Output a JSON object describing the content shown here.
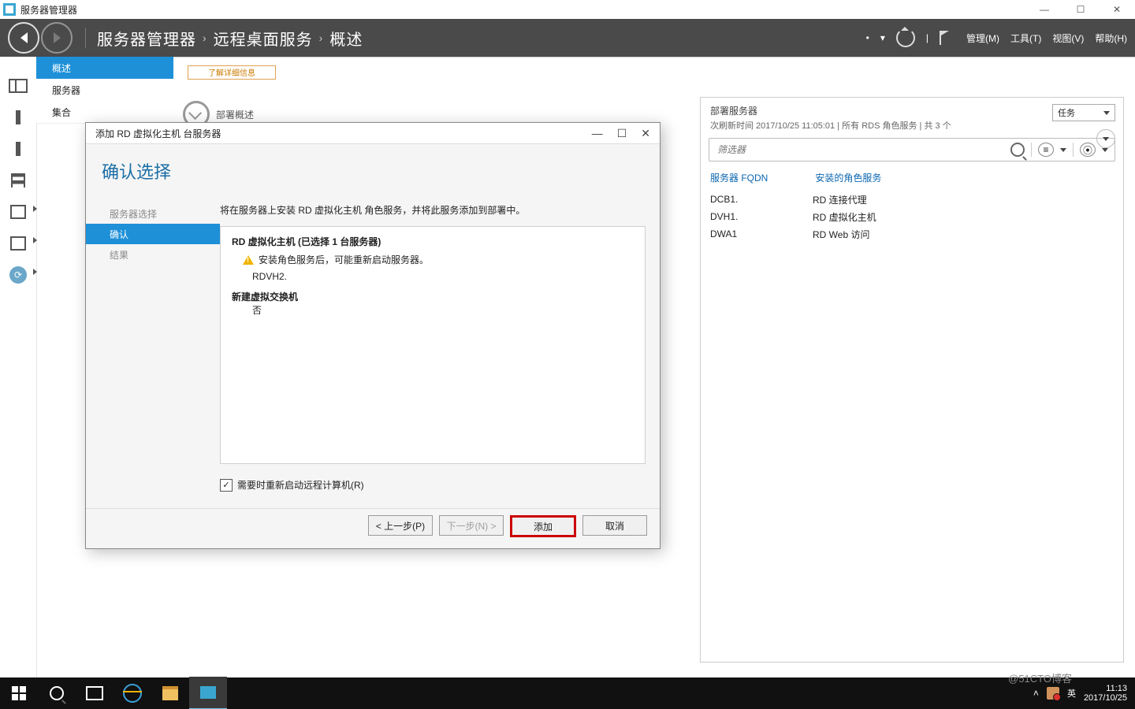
{
  "app_title": "服务器管理器",
  "window_controls": {
    "min": "—",
    "max": "☐",
    "close": "✕"
  },
  "breadcrumb": [
    "服务器管理器",
    "远程桌面服务",
    "概述"
  ],
  "header_menu": {
    "manage": "管理(M)",
    "tools": "工具(T)",
    "view": "视图(V)",
    "help": "帮助(H)"
  },
  "header_misc": {
    "bullet": "•",
    "caret": "▾",
    "vbar": "|"
  },
  "side_nav": {
    "overview": "概述",
    "servers": "服务器",
    "collections": "集合"
  },
  "orange_strip": "了解详细信息",
  "main": {
    "dep_overview_title": "部署概述"
  },
  "right_panel": {
    "title": "部署服务器",
    "sub": "次刷新时间 2017/10/25 11:05:01 | 所有 RDS 角色服务 | 共 3 个",
    "tasks_label": "任务",
    "filter_placeholder": "筛选器",
    "col_fqdn": "服务器 FQDN",
    "col_role": "安装的角色服务",
    "rows": [
      {
        "fqdn": "DCB1.",
        "role": "RD 连接代理"
      },
      {
        "fqdn": "DVH1.",
        "role": "RD 虚拟化主机"
      },
      {
        "fqdn": "DWA1",
        "role": "RD Web 访问"
      }
    ]
  },
  "modal": {
    "title": "添加 RD 虚拟化主机 台服务器",
    "heading": "确认选择",
    "steps": {
      "select": "服务器选择",
      "confirm": "确认",
      "result": "结果"
    },
    "note": "将在服务器上安装 RD 虚拟化主机 角色服务，并将此服务添加到部署中。",
    "host_header": "RD 虚拟化主机  (已选择 1 台服务器)",
    "warn_text": "安装角色服务后，可能重新启动服务器。",
    "server_name": "RDVH2.",
    "switch_header": "新建虚拟交换机",
    "switch_value": "否",
    "checkbox_label": "需要时重新启动远程计算机(R)",
    "buttons": {
      "prev": "< 上一步(P)",
      "next": "下一步(N) >",
      "add": "添加",
      "cancel": "取消"
    },
    "win_min": "—",
    "win_max": "☐",
    "win_close": "✕"
  },
  "taskbar": {
    "ime": "英",
    "time": "11:13",
    "date": "2017/10/25"
  },
  "watermark": "@51CTO博客"
}
